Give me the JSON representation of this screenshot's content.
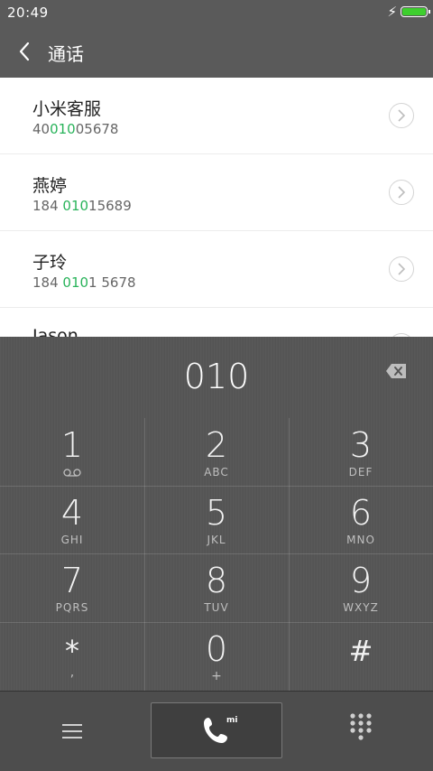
{
  "status_bar": {
    "time": "20:49",
    "charging_icon": "bolt-icon",
    "battery_color": "#3ecf2e"
  },
  "header": {
    "title": "通话",
    "back_icon": "chevron-left-icon"
  },
  "contacts": [
    {
      "name": "小米客服",
      "number_pre": "40",
      "number_match": "010",
      "number_post": "05678"
    },
    {
      "name": "燕婷",
      "number_pre": "184 ",
      "number_match": "010",
      "number_post": "15689"
    },
    {
      "name": "子玲",
      "number_pre": "184 ",
      "number_match": "010",
      "number_post": "1 5678"
    },
    {
      "name": "Jason",
      "number_pre": "",
      "number_match": "",
      "number_post": ""
    }
  ],
  "dialer": {
    "input": "010",
    "keys": [
      {
        "digit": "1",
        "letters": ""
      },
      {
        "digit": "2",
        "letters": "ABC"
      },
      {
        "digit": "3",
        "letters": "DEF"
      },
      {
        "digit": "4",
        "letters": "GHI"
      },
      {
        "digit": "5",
        "letters": "JKL"
      },
      {
        "digit": "6",
        "letters": "MNO"
      },
      {
        "digit": "7",
        "letters": "PQRS"
      },
      {
        "digit": "8",
        "letters": "TUV"
      },
      {
        "digit": "9",
        "letters": "WXYZ"
      },
      {
        "digit": "*",
        "letters": ","
      },
      {
        "digit": "0",
        "letters": "+"
      },
      {
        "digit": "#",
        "letters": ""
      }
    ],
    "call_badge": "mi"
  },
  "colors": {
    "match_highlight": "#29b35a",
    "bar_bg": "#5a5a5a",
    "dialer_bg": "#555555"
  }
}
